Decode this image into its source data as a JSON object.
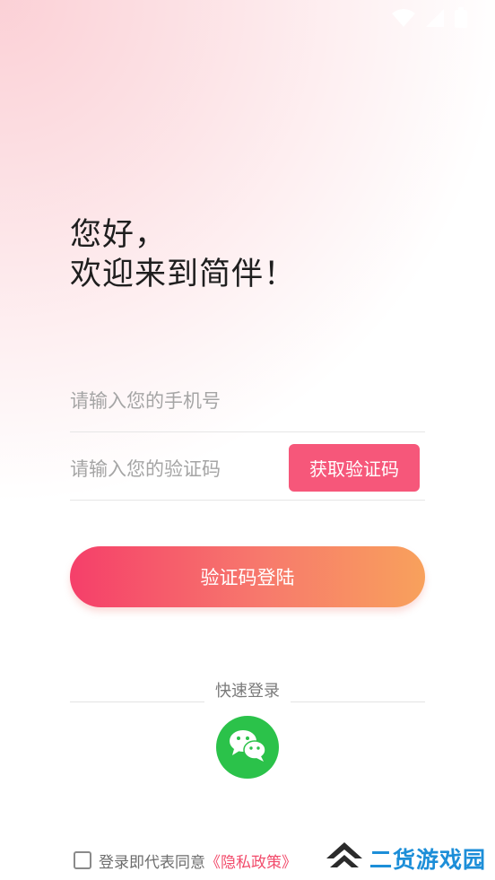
{
  "greeting": {
    "line1": "您好，",
    "line2": "欢迎来到简伴！"
  },
  "phone": {
    "placeholder": "请输入您的手机号",
    "value": ""
  },
  "code": {
    "placeholder": "请输入您的验证码",
    "value": "",
    "get_code_label": "获取验证码"
  },
  "login": {
    "label": "验证码登陆"
  },
  "quick_login": {
    "label": "快速登录",
    "wechat_icon": "wechat-icon"
  },
  "agreement": {
    "checked": false,
    "prefix": "登录即代表同意",
    "policy_link": "《隐私政策》"
  },
  "watermark": {
    "text": "二货游戏园"
  },
  "colors": {
    "accent": "#f6577a",
    "gradient_start": "#f53f6a",
    "gradient_end": "#f8a15c",
    "wechat": "#2bc24a",
    "link": "#f24b6b",
    "watermark": "#1c8ed8"
  }
}
